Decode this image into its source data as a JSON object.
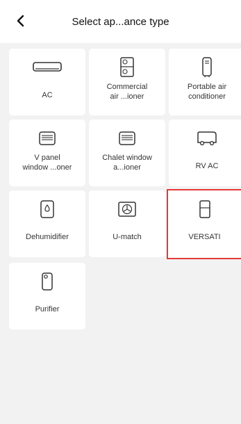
{
  "header": {
    "title": "Select ap...ance type"
  },
  "appliances": [
    {
      "label": "AC",
      "icon": "wall-ac-icon"
    },
    {
      "label": "Commercial\nair ...ioner",
      "icon": "commercial-ac-icon"
    },
    {
      "label": "Portable air\nconditioner",
      "icon": "portable-ac-icon"
    },
    {
      "label": "V panel\nwindow ...oner",
      "icon": "window-ac-icon"
    },
    {
      "label": "Chalet window\na...ioner",
      "icon": "chalet-window-ac-icon"
    },
    {
      "label": "RV AC",
      "icon": "rv-ac-icon"
    },
    {
      "label": "Dehumidifier",
      "icon": "dehumidifier-icon"
    },
    {
      "label": "U-match",
      "icon": "fan-box-icon"
    },
    {
      "label": "VERSATI",
      "icon": "versati-unit-icon",
      "selected": true
    },
    {
      "label": "Purifier",
      "icon": "purifier-icon"
    }
  ],
  "colors": {
    "background": "#f2f2f2",
    "tile": "#ffffff",
    "selection": "#e53935"
  }
}
